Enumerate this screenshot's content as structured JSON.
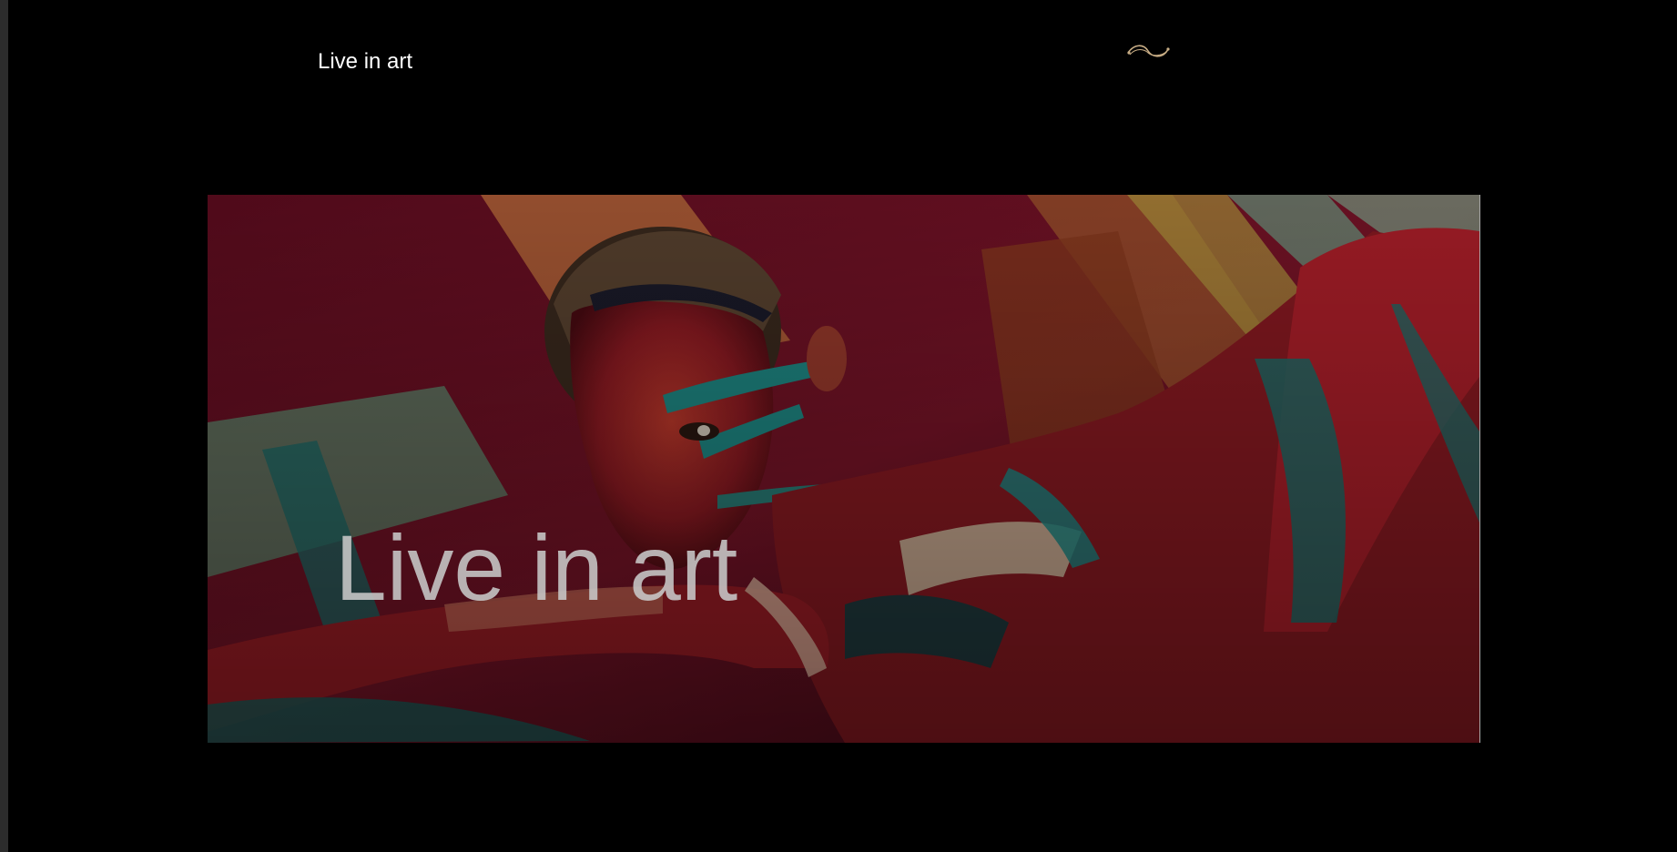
{
  "header": {
    "site_title": "Live in art",
    "ornament_icon": "flourish-icon",
    "ornament_color": "#c8ad85"
  },
  "hero": {
    "title": "Live in art",
    "image_alt_icon": "painted-woman-image"
  },
  "colors": {
    "background": "#000000",
    "hero_text": "#c9c9c9"
  }
}
